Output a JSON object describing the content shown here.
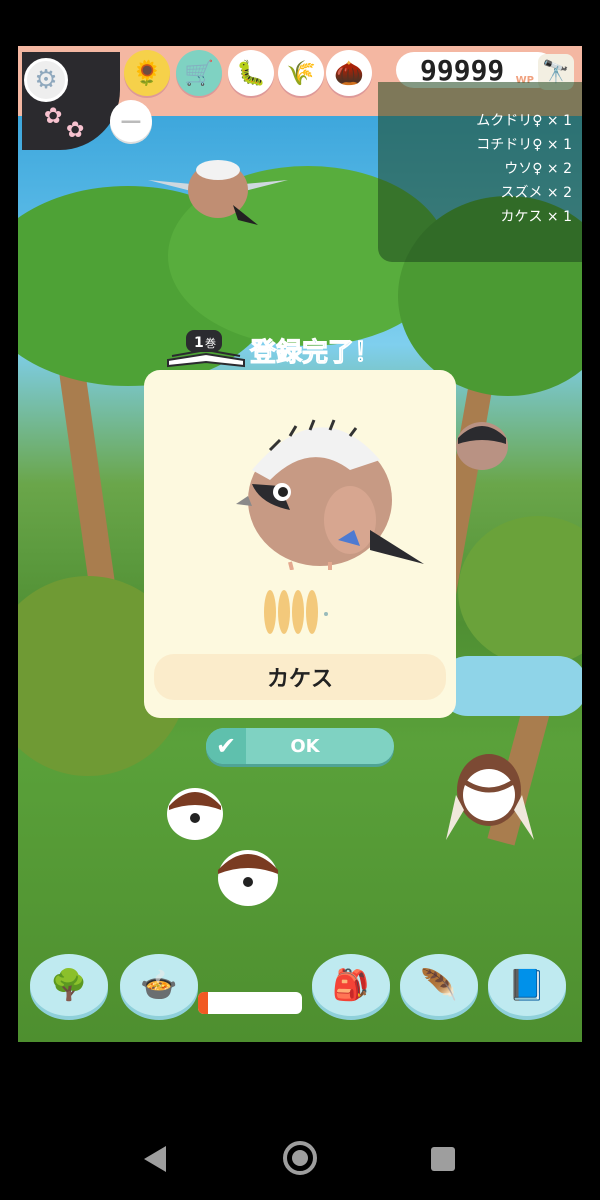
{
  "header": {
    "wp_value": "99999",
    "wp_unit": "WP"
  },
  "bird_list": [
    "ムクドリ♀ × 1",
    "コチドリ♀ × 1",
    "ウソ♀ × 2",
    "スズメ × 2",
    "カケス × 1"
  ],
  "registration": {
    "volume_number": "1",
    "volume_suffix": "巻",
    "title": "登録完了！",
    "bird_name": "カケス",
    "rarity_feathers": 4,
    "ok_label": "OK"
  },
  "feed": {
    "level": 0.1
  },
  "icons": {
    "top": [
      "gear-icon",
      "sunflower-seed-icon",
      "shop-cart-icon",
      "caterpillar-icon",
      "grain-icon",
      "nut-icon",
      "binoculars-icon"
    ],
    "bottom": [
      "tree-rotate-icon",
      "feeder-icon",
      "backpack-icon",
      "quill-icon",
      "book-icon"
    ],
    "nav": [
      "back-icon",
      "home-icon",
      "recents-icon"
    ]
  },
  "colors": {
    "topbar": "#f4b7a2",
    "accent": "#3aa7c7",
    "ok_button": "#7fd2c2",
    "feed_fill": "#f15a24"
  }
}
